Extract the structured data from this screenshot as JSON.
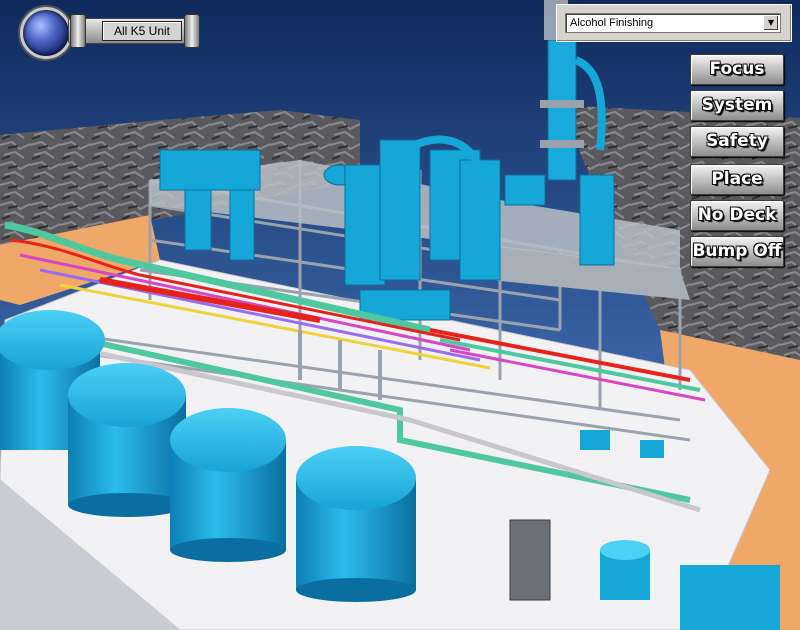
{
  "unit_selector": {
    "label": "All K5 Unit"
  },
  "area_dropdown": {
    "selected": "Alcohol Finishing"
  },
  "side_buttons": [
    {
      "label": "Focus"
    },
    {
      "label": "System"
    },
    {
      "label": "Safety"
    },
    {
      "label": "Place"
    },
    {
      "label": "No Deck"
    },
    {
      "label": "Bump Off"
    }
  ],
  "colors": {
    "sky": "#2a4f8a",
    "deck": "#f2f2f4",
    "ground": "#f0a868",
    "tank": "#16a7d9",
    "steel": "#9aa3ad",
    "pipe_red": "#e8221a",
    "pipe_green": "#4fc8a0",
    "pipe_magenta": "#d846c8"
  },
  "icons": [
    "blue-orb-knob-icon",
    "dropdown-arrow-icon"
  ]
}
